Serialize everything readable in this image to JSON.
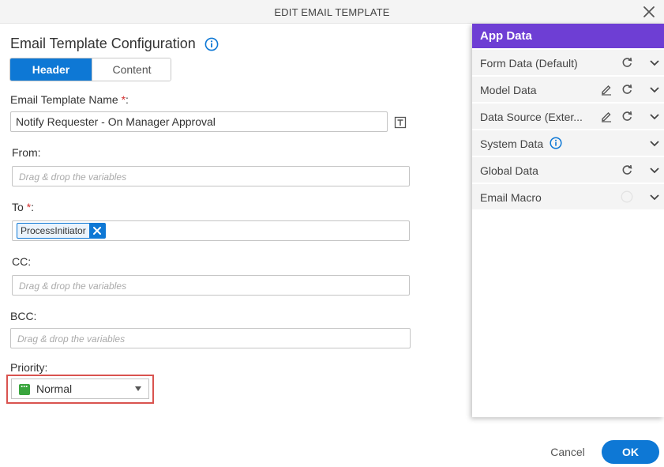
{
  "dialog": {
    "title": "EDIT EMAIL TEMPLATE"
  },
  "config": {
    "title": "Email Template Configuration"
  },
  "tabs": [
    {
      "label": "Header",
      "active": true
    },
    {
      "label": "Content",
      "active": false
    }
  ],
  "form": {
    "name_label": "Email Template Name",
    "required_mark": "*",
    "name_value": "Notify Requester - On Manager Approval",
    "from_label": "From:",
    "from_placeholder": "Drag & drop the variables",
    "to_label": "To",
    "to_chip": "ProcessInitiator",
    "cc_label": "CC:",
    "cc_placeholder": "Drag & drop the variables",
    "bcc_label": "BCC:",
    "bcc_placeholder": "Drag & drop the variables",
    "priority_label": "Priority:",
    "priority_value": "Normal"
  },
  "app_data": {
    "title": "App Data",
    "rows": [
      {
        "label": "Form Data (Default)",
        "icons": [
          "refresh-icon",
          "chevron-down-icon"
        ]
      },
      {
        "label": "Model Data",
        "icons": [
          "edit-icon",
          "refresh-icon",
          "chevron-down-icon"
        ]
      },
      {
        "label": "Data Source (Exter...",
        "icons": [
          "edit-icon",
          "refresh-icon",
          "chevron-down-icon"
        ]
      },
      {
        "label": "System Data",
        "icons": [
          "info-icon",
          "chevron-down-icon"
        ]
      },
      {
        "label": "Global Data",
        "icons": [
          "refresh-icon",
          "chevron-down-icon"
        ]
      },
      {
        "label": "Email Macro",
        "icons": [
          "help-icon",
          "chevron-down-icon"
        ]
      }
    ]
  },
  "footer": {
    "cancel_label": "Cancel",
    "ok_label": "OK"
  },
  "colors": {
    "primary": "#0e78d5",
    "panel_header": "#6e3ed4",
    "required": "#d32f2f",
    "priority_normal": "#3aa53e",
    "highlight": "#d9534f"
  }
}
